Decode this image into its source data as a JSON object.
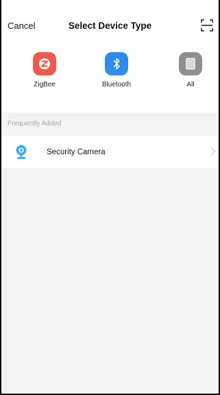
{
  "header": {
    "cancel_label": "Cancel",
    "title": "Select Device Type",
    "scan_icon": "scan-icon"
  },
  "device_types": [
    {
      "label": "ZigBee",
      "icon": "zigbee-icon",
      "color": "#ef5a4a"
    },
    {
      "label": "Bluetooth",
      "icon": "bluetooth-icon",
      "color": "#2f8bea"
    },
    {
      "label": "All",
      "icon": "all-devices-icon",
      "color": "#8e8e93"
    }
  ],
  "frequently_added": {
    "header": "Frequently Added",
    "items": [
      {
        "label": "Security Camera",
        "icon": "security-camera-icon",
        "color": "#3fa9f5"
      }
    ]
  }
}
